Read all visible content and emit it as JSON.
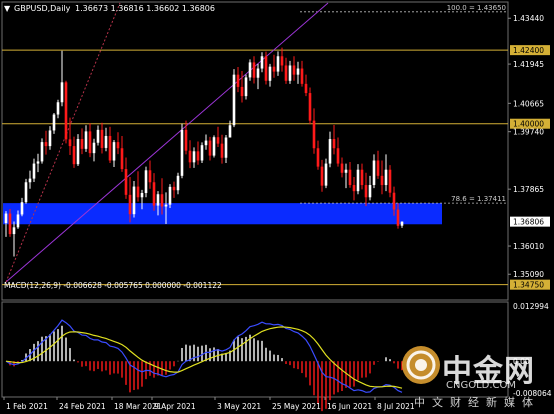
{
  "header": {
    "menu_arrow": "▼",
    "symbol_label": "GBPUSD,Daily",
    "ohlc": "1.36673 1.36816 1.36602 1.36806"
  },
  "colors": {
    "background": "#000000",
    "bull": "#ffffff",
    "bear": "#ff1a1a",
    "fib_line": "#ffffff",
    "level_line": "#d4b036",
    "zone": "#0a2bff",
    "channel": "#9b35d6",
    "macd_hist_pos": "#ffffff",
    "macd_hist_neg": "#ff1a1a",
    "macd_line": "#3a4cff",
    "signal_line": "#e0e020",
    "axis_text": "#ffffff"
  },
  "chart_data": {
    "type": "candlestick",
    "symbol": "GBPUSD",
    "timeframe": "Daily",
    "ylim": [
      1.3425,
      1.4397
    ],
    "y_ticks": [
      "1.43440",
      "1.41945",
      "1.40665",
      "1.39740",
      "1.37865",
      "1.36010",
      "1.35090"
    ],
    "x_ticks": [
      "1 Feb 2021",
      "24 Feb 2021",
      "18 Mar 2021",
      "9 Apr 2021",
      "3 May 2021",
      "25 May 2021",
      "16 Jun 2021",
      "8 Jul 2021"
    ],
    "candles": [
      [
        1.3676,
        1.3715,
        1.3631,
        1.3707
      ],
      [
        1.3707,
        1.3722,
        1.3631,
        1.364
      ],
      [
        1.364,
        1.3681,
        1.3567,
        1.3662
      ],
      [
        1.3662,
        1.3717,
        1.3657,
        1.3704
      ],
      [
        1.3704,
        1.3758,
        1.3698,
        1.3744
      ],
      [
        1.3744,
        1.382,
        1.3739,
        1.3809
      ],
      [
        1.3809,
        1.3847,
        1.3788,
        1.3821
      ],
      [
        1.3821,
        1.3886,
        1.381,
        1.387
      ],
      [
        1.387,
        1.3902,
        1.3842,
        1.3877
      ],
      [
        1.3877,
        1.3952,
        1.387,
        1.394
      ],
      [
        1.394,
        1.3977,
        1.3899,
        1.3927
      ],
      [
        1.3927,
        1.3992,
        1.3915,
        1.3978
      ],
      [
        1.3978,
        1.4035,
        1.3967,
        1.403
      ],
      [
        1.403,
        1.4078,
        1.4018,
        1.407
      ],
      [
        1.407,
        1.4238,
        1.4057,
        1.4135
      ],
      [
        1.4135,
        1.414,
        1.3936,
        1.3949
      ],
      [
        1.3949,
        1.402,
        1.3898,
        1.3927
      ],
      [
        1.3927,
        1.3958,
        1.3856,
        1.3868
      ],
      [
        1.3868,
        1.3966,
        1.3862,
        1.395
      ],
      [
        1.395,
        1.3985,
        1.3901,
        1.3918
      ],
      [
        1.3918,
        1.3995,
        1.3908,
        1.3975
      ],
      [
        1.3975,
        1.4001,
        1.3891,
        1.3904
      ],
      [
        1.3904,
        1.3951,
        1.3877,
        1.3938
      ],
      [
        1.3938,
        1.3994,
        1.3929,
        1.398
      ],
      [
        1.398,
        1.4003,
        1.3903,
        1.3921
      ],
      [
        1.3921,
        1.3987,
        1.391,
        1.396
      ],
      [
        1.396,
        1.399,
        1.3872,
        1.388
      ],
      [
        1.388,
        1.3947,
        1.3859,
        1.394
      ],
      [
        1.394,
        1.3972,
        1.3901,
        1.392
      ],
      [
        1.392,
        1.396,
        1.3843,
        1.3852
      ],
      [
        1.3852,
        1.389,
        1.3755,
        1.3768
      ],
      [
        1.3768,
        1.3826,
        1.3678,
        1.3705
      ],
      [
        1.3705,
        1.3813,
        1.3694,
        1.3795
      ],
      [
        1.3795,
        1.3845,
        1.3746,
        1.376
      ],
      [
        1.376,
        1.3784,
        1.3721,
        1.3774
      ],
      [
        1.3774,
        1.386,
        1.376,
        1.3848
      ],
      [
        1.3848,
        1.388,
        1.3788,
        1.3809
      ],
      [
        1.3809,
        1.3839,
        1.3716,
        1.3733
      ],
      [
        1.3733,
        1.378,
        1.3701,
        1.377
      ],
      [
        1.377,
        1.3822,
        1.3704,
        1.373
      ],
      [
        1.373,
        1.3776,
        1.3673,
        1.3736
      ],
      [
        1.3736,
        1.3803,
        1.3725,
        1.3794
      ],
      [
        1.3794,
        1.3811,
        1.3758,
        1.3783
      ],
      [
        1.3783,
        1.384,
        1.377,
        1.383
      ],
      [
        1.383,
        1.4,
        1.3822,
        1.398
      ],
      [
        1.398,
        1.401,
        1.39,
        1.3912
      ],
      [
        1.3912,
        1.3946,
        1.3855,
        1.3874
      ],
      [
        1.3874,
        1.3923,
        1.3856,
        1.391
      ],
      [
        1.391,
        1.3942,
        1.3866,
        1.388
      ],
      [
        1.388,
        1.3939,
        1.3872,
        1.393
      ],
      [
        1.393,
        1.3965,
        1.3915,
        1.3945
      ],
      [
        1.3945,
        1.3957,
        1.388,
        1.3896
      ],
      [
        1.3896,
        1.3962,
        1.389,
        1.3956
      ],
      [
        1.3956,
        1.399,
        1.3924,
        1.3935
      ],
      [
        1.3935,
        1.3964,
        1.387,
        1.3889
      ],
      [
        1.3889,
        1.3963,
        1.3872,
        1.3955
      ],
      [
        1.3955,
        1.401,
        1.3955,
        1.3995
      ],
      [
        1.3995,
        1.4178,
        1.3989,
        1.416
      ],
      [
        1.416,
        1.4185,
        1.4103,
        1.412
      ],
      [
        1.412,
        1.4172,
        1.4069,
        1.409
      ],
      [
        1.409,
        1.416,
        1.4079,
        1.4151
      ],
      [
        1.4151,
        1.421,
        1.414,
        1.42
      ],
      [
        1.42,
        1.422,
        1.4131,
        1.415
      ],
      [
        1.415,
        1.4195,
        1.4113,
        1.418
      ],
      [
        1.418,
        1.4233,
        1.4168,
        1.422
      ],
      [
        1.422,
        1.4235,
        1.4128,
        1.414
      ],
      [
        1.414,
        1.4195,
        1.4121,
        1.4186
      ],
      [
        1.4186,
        1.4225,
        1.415,
        1.417
      ],
      [
        1.417,
        1.4236,
        1.4156,
        1.422
      ],
      [
        1.422,
        1.4248,
        1.417,
        1.419
      ],
      [
        1.419,
        1.4215,
        1.413,
        1.414
      ],
      [
        1.414,
        1.4205,
        1.413,
        1.419
      ],
      [
        1.419,
        1.422,
        1.414,
        1.416
      ],
      [
        1.416,
        1.4202,
        1.413,
        1.418
      ],
      [
        1.418,
        1.4205,
        1.4121,
        1.413
      ],
      [
        1.413,
        1.416,
        1.409,
        1.41
      ],
      [
        1.41,
        1.4118,
        1.3998,
        1.401
      ],
      [
        1.401,
        1.405,
        1.3902,
        1.392
      ],
      [
        1.392,
        1.3945,
        1.385,
        1.386
      ],
      [
        1.386,
        1.3882,
        1.3778,
        1.3798
      ],
      [
        1.3798,
        1.3886,
        1.379,
        1.387
      ],
      [
        1.387,
        1.3974,
        1.3858,
        1.395
      ],
      [
        1.395,
        1.3996,
        1.39,
        1.392
      ],
      [
        1.392,
        1.3955,
        1.386,
        1.387
      ],
      [
        1.387,
        1.389,
        1.3825,
        1.384
      ],
      [
        1.384,
        1.387,
        1.379,
        1.385
      ],
      [
        1.385,
        1.3875,
        1.3791,
        1.38
      ],
      [
        1.38,
        1.3826,
        1.375,
        1.378
      ],
      [
        1.378,
        1.3868,
        1.377,
        1.385
      ],
      [
        1.385,
        1.387,
        1.3786,
        1.38
      ],
      [
        1.38,
        1.384,
        1.3731,
        1.376
      ],
      [
        1.376,
        1.383,
        1.375,
        1.38
      ],
      [
        1.38,
        1.39,
        1.379,
        1.388
      ],
      [
        1.388,
        1.3912,
        1.382,
        1.383
      ],
      [
        1.383,
        1.388,
        1.377,
        1.38
      ],
      [
        1.38,
        1.39,
        1.378,
        1.385
      ],
      [
        1.385,
        1.3865,
        1.376,
        1.3775
      ],
      [
        1.3775,
        1.3795,
        1.37,
        1.372
      ],
      [
        1.372,
        1.3741,
        1.3658,
        1.3667
      ],
      [
        1.36673,
        1.36816,
        1.36602,
        1.36806
      ]
    ],
    "price_labels": [
      {
        "value": 1.4365,
        "text": "100.0 = 1.43650",
        "kind": "fib"
      },
      {
        "value": 1.424,
        "text": "1.42400",
        "kind": "level"
      },
      {
        "value": 1.4,
        "text": "1.40000",
        "kind": "level"
      },
      {
        "value": 1.37411,
        "text": "78.6 = 1.37411",
        "kind": "fib"
      },
      {
        "value": 1.36806,
        "text": "1.36806",
        "kind": "current"
      },
      {
        "value": 1.3475,
        "text": "1.34750",
        "kind": "level"
      }
    ],
    "zone": {
      "from": 1.3672,
      "to": 1.3741
    },
    "macd": {
      "label": "MACD(12,26,9) -0.006628 -0.005765 0.000000 -0.001122",
      "ylim": [
        -0.0081,
        0.0134
      ],
      "y_ticks": [
        "0.012994",
        "0.00",
        "-0.008064"
      ]
    }
  },
  "watermark": {
    "cn": "中金网",
    "en": "CNGOLD.COM",
    "tag": "中文财经新媒体",
    "logo": "gold-coin-logo"
  }
}
